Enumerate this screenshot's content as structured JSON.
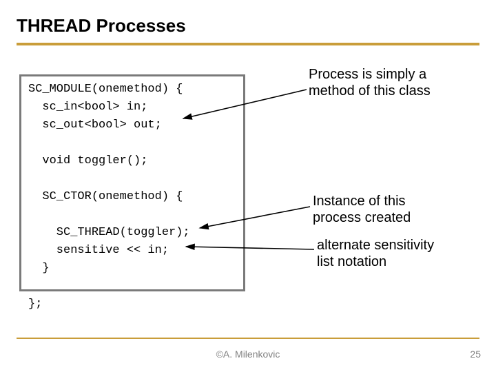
{
  "title": "THREAD Processes",
  "code": "SC_MODULE(onemethod) {\n  sc_in<bool> in;\n  sc_out<bool> out;\n\n  void toggler();\n\n  SC_CTOR(onemethod) {\n\n    SC_THREAD(toggler);\n    sensitive << in;\n  }\n\n};",
  "annotations": {
    "a1": "Process is simply a method of this class",
    "a2": "Instance of this process created",
    "a3": "alternate sensitivity list notation"
  },
  "footer": {
    "author": "©A. Milenkovic",
    "page": "25"
  }
}
